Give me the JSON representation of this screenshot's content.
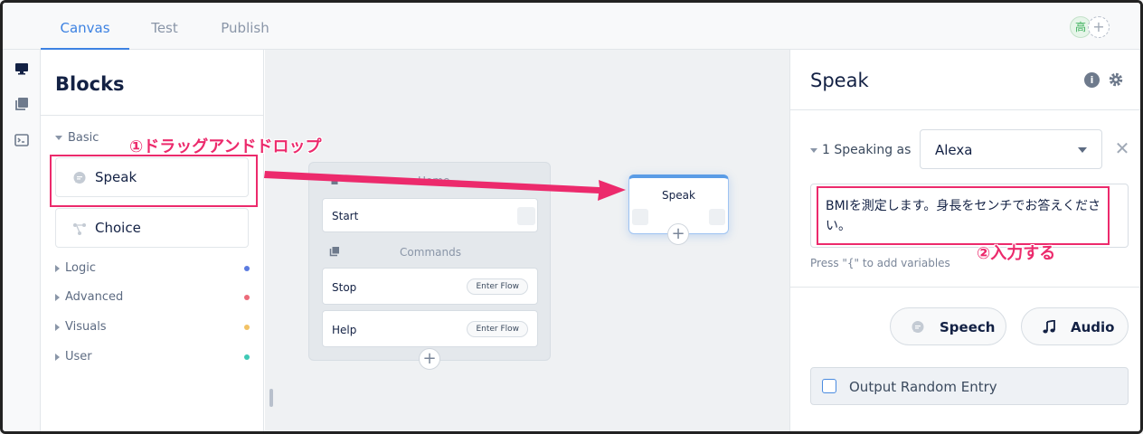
{
  "tabs": [
    {
      "label": "Canvas",
      "active": true
    },
    {
      "label": "Test",
      "active": false
    },
    {
      "label": "Publish",
      "active": false
    }
  ],
  "users": {
    "initial": "高",
    "add_symbol": "+"
  },
  "rail_icons": [
    "monitor-icon",
    "library-icon",
    "console-icon"
  ],
  "blocks_panel": {
    "title": "Blocks",
    "basic_label": "Basic",
    "basic_items": [
      {
        "label": "Speak",
        "icon": "speech-bubble-icon"
      },
      {
        "label": "Choice",
        "icon": "branch-icon"
      }
    ],
    "categories": [
      {
        "label": "Logic",
        "color": "#5b7be0"
      },
      {
        "label": "Advanced",
        "color": "#ec6b7a"
      },
      {
        "label": "Visuals",
        "color": "#f2c265"
      },
      {
        "label": "User",
        "color": "#3fc9b5"
      }
    ]
  },
  "canvas": {
    "home_group": {
      "title": "Home",
      "start_label": "Start",
      "commands_label": "Commands",
      "commands": [
        {
          "label": "Stop",
          "button": "Enter Flow"
        },
        {
          "label": "Help",
          "button": "Enter Flow"
        }
      ],
      "add_symbol": "+"
    },
    "speak_node": {
      "label": "Speak",
      "add_symbol": "+"
    }
  },
  "inspector": {
    "title": "Speak",
    "info_symbol": "i",
    "speaking_label": "1 Speaking as",
    "speaking_value": "Alexa",
    "close_symbol": "✕",
    "text": "BMIを測定します。身長をセンチでお答えください。",
    "hint": "Press \"{\" to add variables",
    "add_speech": "Speech",
    "add_audio": "Audio",
    "output_random": "Output Random Entry"
  },
  "annotations": {
    "drag_drop": "①ドラッグアンドドロップ",
    "input": "②入力する",
    "color": "#ec2a6c"
  }
}
